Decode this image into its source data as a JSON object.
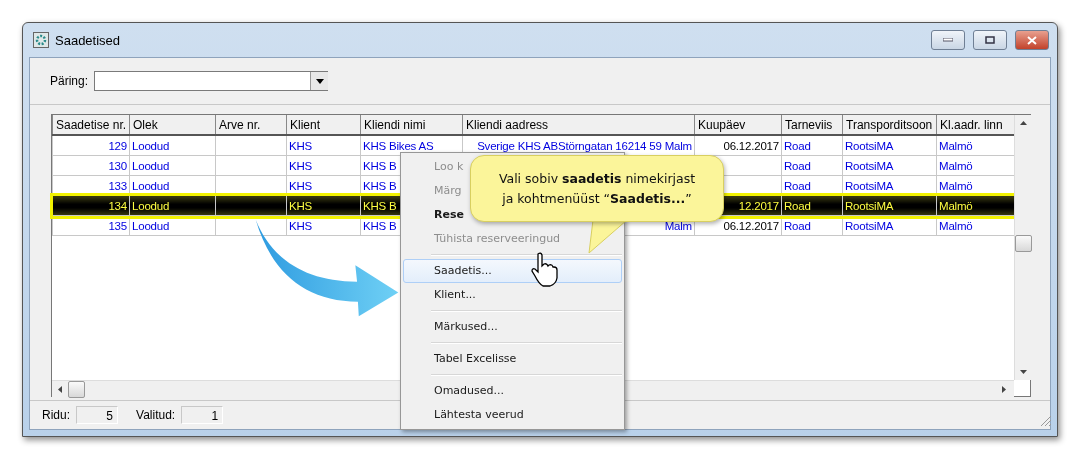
{
  "window": {
    "title": "Saadetised"
  },
  "query": {
    "label": "Päring:"
  },
  "table": {
    "columns": [
      {
        "label": "Saadetise nr.",
        "kind": "number"
      },
      {
        "label": "Olek",
        "kind": "text"
      },
      {
        "label": "Arve nr.",
        "kind": "text"
      },
      {
        "label": "Klient",
        "kind": "text"
      },
      {
        "label": "Kliendi nimi",
        "kind": "text"
      },
      {
        "label": "Kliendi aadress",
        "kind": "address"
      },
      {
        "label": "Kuupäev",
        "kind": "date"
      },
      {
        "label": "Tarneviis",
        "kind": "text"
      },
      {
        "label": "Transporditsoon",
        "kind": "text"
      },
      {
        "label": "Kl.aadr. linn",
        "kind": "text"
      }
    ],
    "rows": [
      {
        "selected": false,
        "cells": [
          "129",
          "Loodud",
          "",
          "KHS",
          "KHS Bikes AS",
          "Sverige KHS ABStörngatan 16214 59 Malm",
          "06.12.2017",
          "Road",
          "RootsiMA",
          "Malmö"
        ]
      },
      {
        "selected": false,
        "cells": [
          "130",
          "Loodud",
          "",
          "KHS",
          "KHS B",
          "",
          "",
          "Road",
          "RootsiMA",
          "Malmö"
        ]
      },
      {
        "selected": false,
        "cells": [
          "133",
          "Loodud",
          "",
          "KHS",
          "KHS B",
          "",
          "",
          "Road",
          "RootsiMA",
          "Malmö"
        ]
      },
      {
        "selected": true,
        "cells": [
          "134",
          "Loodud",
          "",
          "KHS",
          "KHS B",
          "",
          "12.2017",
          "Road",
          "RootsiMA",
          "Malmö"
        ]
      },
      {
        "selected": false,
        "cells": [
          "135",
          "Loodud",
          "",
          "KHS",
          "KHS B",
          "Malm",
          "06.12.2017",
          "Road",
          "RootsiMA",
          "Malmö"
        ]
      }
    ]
  },
  "context_menu": {
    "items": [
      {
        "kind": "item",
        "label": "Loo k",
        "disabled": true,
        "bold": false,
        "selected": false
      },
      {
        "kind": "item",
        "label": "Märg",
        "disabled": true,
        "bold": false,
        "selected": false
      },
      {
        "kind": "item",
        "label": "Rese",
        "disabled": false,
        "bold": true,
        "selected": false
      },
      {
        "kind": "item",
        "label": "Tühista reserveeringud",
        "disabled": true,
        "bold": false,
        "selected": false
      },
      {
        "kind": "separator"
      },
      {
        "kind": "item",
        "label": "Saadetis...",
        "disabled": false,
        "bold": false,
        "selected": true
      },
      {
        "kind": "item",
        "label": "Klient...",
        "disabled": false,
        "bold": false,
        "selected": false
      },
      {
        "kind": "separator"
      },
      {
        "kind": "item",
        "label": "Märkused...",
        "disabled": false,
        "bold": false,
        "selected": false
      },
      {
        "kind": "separator"
      },
      {
        "kind": "item",
        "label": "Tabel Excelisse",
        "disabled": false,
        "bold": false,
        "selected": false
      },
      {
        "kind": "separator"
      },
      {
        "kind": "item",
        "label": "Omadused...",
        "disabled": false,
        "bold": false,
        "selected": false
      },
      {
        "kind": "item",
        "label": "Lähtesta veerud",
        "disabled": false,
        "bold": false,
        "selected": false
      }
    ]
  },
  "callout": {
    "lines": [
      "Vali sobiv **saadetis** nimekirjast",
      "ja kohtmenüüst “**Saadetis...**”"
    ]
  },
  "status_bar": {
    "rows_label": "Ridu:",
    "rows_value": "5",
    "selected_label": "Valitud:",
    "selected_value": "1"
  }
}
